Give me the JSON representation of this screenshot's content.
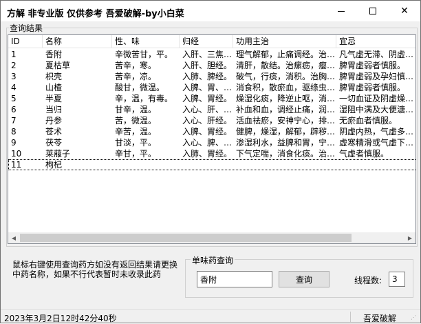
{
  "window": {
    "title": "方解 非专业版  仅供参考 吾爱破解-by小白菜"
  },
  "results": {
    "group_label": "查询结果",
    "columns": [
      "ID",
      "名称",
      "性、味",
      "归经",
      "功用主治",
      "宜忌"
    ],
    "rows": [
      {
        "id": "1",
        "name": "香附",
        "taste": "辛微苦甘，平。",
        "meridian": "入肝、三焦经。",
        "func": "理气解郁，止痛调经。治肝胃不和",
        "note": "凡气虚无滞、阴虚血热者忌服"
      },
      {
        "id": "2",
        "name": "夏枯草",
        "taste": "苦辛，寒。",
        "meridian": "入肝、胆经。",
        "func": "清肝，散结。治瘰疬，瘿瘤，乳痈",
        "note": "脾胃虚弱者慎服。"
      },
      {
        "id": "3",
        "name": "枳壳",
        "taste": "苦辛，凉。",
        "meridian": "入肺、脾经。",
        "func": "破气，行痰，消积。治胸膈痰滞",
        "note": "脾胃虚弱及孕妇慎服。"
      },
      {
        "id": "4",
        "name": "山楂",
        "taste": "酸甘，微温。",
        "meridian": "入脾、胃、肝经。",
        "func": "消食积，散瘀血，驱绦虫。治肉积",
        "note": "脾胃虚弱者慎服。"
      },
      {
        "id": "5",
        "name": "半夏",
        "taste": "辛，温，有毒。",
        "meridian": "入脾、胃经。",
        "func": "燥湿化痰，降逆止呕，消痞散结",
        "note": "一切血证及阴虚燥咳者忌服"
      },
      {
        "id": "6",
        "name": "当归",
        "taste": "甘辛，温。",
        "meridian": "入心、肝、脾经。",
        "func": "补血和血，调经止痛，润燥滑肠",
        "note": "湿阻中满及大便溏泄者慎服"
      },
      {
        "id": "7",
        "name": "丹参",
        "taste": "苦，微温。",
        "meridian": "入心、肝经。",
        "func": "活血祛瘀，安神宁心，排脓止痛",
        "note": "无瘀血者慎服。"
      },
      {
        "id": "8",
        "name": "苍术",
        "taste": "辛苦，温。",
        "meridian": "入脾、胃经。",
        "func": "健脾，燥湿，解郁，辟秽。治湿盛",
        "note": "阴虚内热，气虚多汗者忌服"
      },
      {
        "id": "9",
        "name": "茯苓",
        "taste": "甘淡，平。",
        "meridian": "入心、脾、肺经。",
        "func": "渗湿利水，益脾和胃，宁心安神",
        "note": "虚寒精滑或气虚下陷者忌服"
      },
      {
        "id": "10",
        "name": "莱菔子",
        "taste": "辛甘，平。",
        "meridian": "入肺、胃经。",
        "func": "下气定喘，消食化痰。治咳嗽痰喘",
        "note": "气虚者慎服。"
      },
      {
        "id": "11",
        "name": "枸杞",
        "taste": "",
        "meridian": "",
        "func": "",
        "note": ""
      }
    ]
  },
  "hint": {
    "text": "鼠标右键使用查询药方如没有返回结果请更换中药名称，如果不行代表暂时未收录此药"
  },
  "single_query": {
    "group_label": "单味药查询",
    "input_value": "香附",
    "button_label": "查询",
    "threads_label": "线程数:",
    "threads_value": "3"
  },
  "status": {
    "datetime": "2023年3月2日12时42分40秒",
    "brand": "吾爱破解"
  }
}
